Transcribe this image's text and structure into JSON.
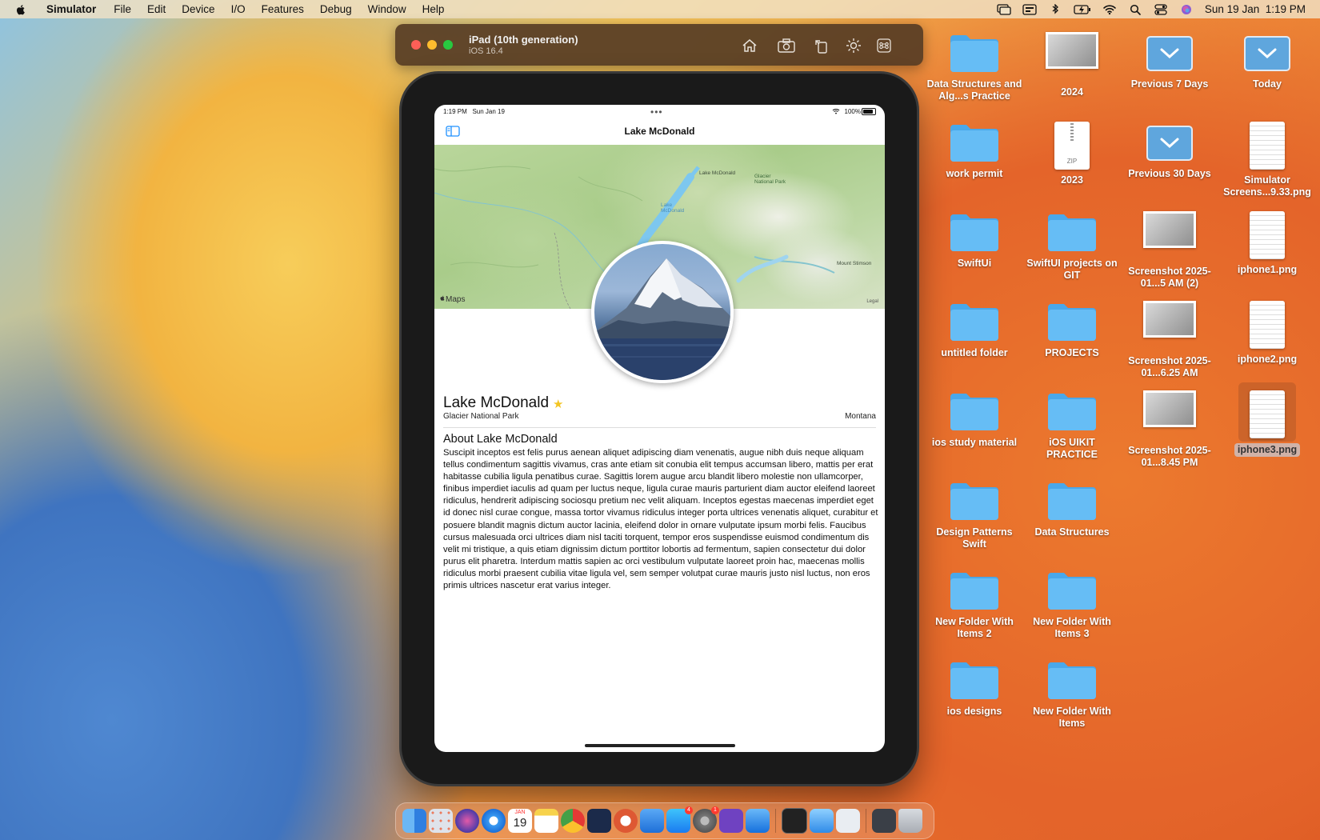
{
  "menubar": {
    "app_name": "Simulator",
    "items": [
      "File",
      "Edit",
      "Device",
      "I/O",
      "Features",
      "Debug",
      "Window",
      "Help"
    ],
    "clock": "Sun 19 Jan  1:19 PM"
  },
  "simulator": {
    "device_name": "iPad (10th generation)",
    "os_version": "iOS 16.4",
    "toolbar_icons": [
      "home-icon",
      "screenshot-icon",
      "rotate-icon",
      "appearance-icon",
      "keyboard-command-icon"
    ]
  },
  "ipad": {
    "status_time": "1:19 PM   Sun Jan 19",
    "battery_pct": "100%",
    "nav_title": "Lake McDonald",
    "map": {
      "labels": {
        "lake_mcdonald_north": "Lake McDonald",
        "glacier_np": "Glacier National Park",
        "lake_mcdonald_south": "Lake McDonald",
        "mount_stimson": "Mount Stimson"
      },
      "maps_badge": "Maps",
      "legal": "Legal"
    },
    "detail": {
      "name": "Lake McDonald",
      "park": "Glacier National Park",
      "state": "Montana",
      "is_favorite": true,
      "about_title": "About Lake McDonald",
      "about_body": "Suscipit inceptos est felis purus aenean aliquet adipiscing diam venenatis, augue nibh duis neque aliquam tellus condimentum sagittis vivamus, cras ante etiam sit conubia elit tempus accumsan libero, mattis per erat habitasse cubilia ligula penatibus curae. Sagittis lorem augue arcu blandit libero molestie non ullamcorper, finibus imperdiet iaculis ad quam per luctus neque, ligula curae mauris parturient diam auctor eleifend laoreet ridiculus, hendrerit adipiscing sociosqu pretium nec velit aliquam. Inceptos egestas maecenas imperdiet eget id donec nisl curae congue, massa tortor vivamus ridiculus integer porta ultrices venenatis aliquet, curabitur et posuere blandit magnis dictum auctor lacinia, eleifend dolor in ornare vulputate ipsum morbi felis. Faucibus cursus malesuada orci ultrices diam nisl taciti torquent, tempor eros suspendisse euismod condimentum dis velit mi tristique, a quis etiam dignissim dictum porttitor lobortis ad fermentum, sapien consectetur dui dolor purus elit pharetra. Interdum mattis sapien ac orci vestibulum vulputate laoreet proin hac, maecenas mollis ridiculus morbi praesent cubilia vitae ligula vel, sem semper volutpat curae mauris justo nisl luctus, non eros primis ultrices nascetur erat varius integer."
    }
  },
  "desktop": {
    "items": [
      {
        "label": "Data Structures and Alg...s Practice",
        "kind": "folder"
      },
      {
        "label": "2024",
        "kind": "screenshot"
      },
      {
        "label": "Previous 7 Days",
        "kind": "stack"
      },
      {
        "label": "Today",
        "kind": "stack"
      },
      {
        "label": "work permit",
        "kind": "folder"
      },
      {
        "label": "2023",
        "kind": "zip"
      },
      {
        "label": "Previous 30 Days",
        "kind": "stack"
      },
      {
        "label": "Simulator Screens...9.33.png",
        "kind": "document"
      },
      {
        "label": "SwiftUi",
        "kind": "folder"
      },
      {
        "label": "SwiftUI projects on GIT",
        "kind": "folder"
      },
      {
        "label": "Screenshot 2025-01...5 AM (2)",
        "kind": "screenshot"
      },
      {
        "label": "iphone1.png",
        "kind": "document"
      },
      {
        "label": "untitled folder",
        "kind": "folder"
      },
      {
        "label": "PROJECTS",
        "kind": "folder"
      },
      {
        "label": "Screenshot 2025-01...6.25 AM",
        "kind": "screenshot"
      },
      {
        "label": "iphone2.png",
        "kind": "document"
      },
      {
        "label": "ios study material",
        "kind": "folder"
      },
      {
        "label": "iOS UIKIT PRACTICE",
        "kind": "folder"
      },
      {
        "label": "Screenshot 2025-01...8.45 PM",
        "kind": "screenshot"
      },
      {
        "label": "iphone3.png",
        "kind": "document"
      },
      {
        "label": "Design Patterns Swift",
        "kind": "folder"
      },
      {
        "label": "Data Structures",
        "kind": "folder"
      },
      {
        "label": "New Folder With Items 2",
        "kind": "folder"
      },
      {
        "label": "New Folder With Items 3",
        "kind": "folder"
      },
      {
        "label": "ios designs",
        "kind": "folder"
      },
      {
        "label": "New Folder With Items",
        "kind": "folder"
      }
    ],
    "zip_badge": "ZIP"
  },
  "dock": {
    "calendar_day": "19",
    "calendar_month": "JAN",
    "appstore_badge": "4",
    "settings_badge": "1",
    "apps": [
      "finder-icon",
      "launchpad-icon",
      "siri-icon",
      "safari-icon",
      "calendar-icon",
      "notes-icon",
      "chrome-icon",
      "instruments-icon",
      "duckduckgo-icon",
      "xcode-helper-icon",
      "app-store-icon",
      "system-settings-icon",
      "github-desktop-icon",
      "xcode-icon",
      "terminal-icon",
      "preview-icon",
      "screenshot-app-icon",
      "downloads-stack-icon",
      "trash-icon"
    ]
  },
  "colors": {
    "accent": "#1e90ff",
    "star": "#f3c523",
    "folder": "#5db7f2"
  }
}
